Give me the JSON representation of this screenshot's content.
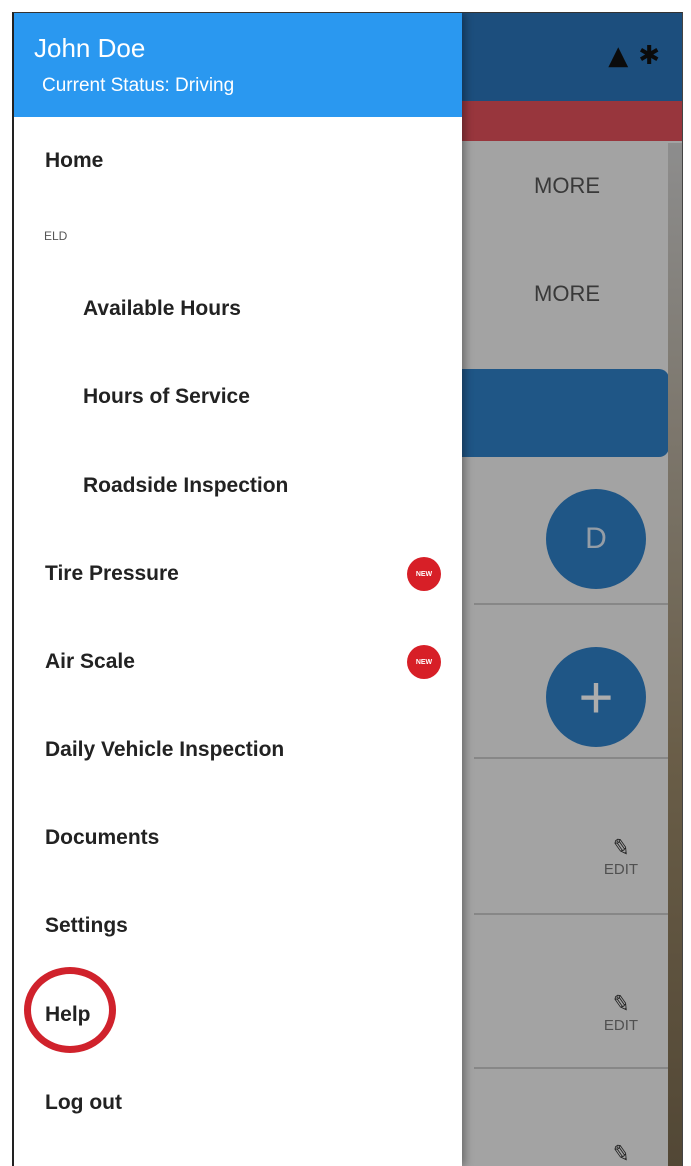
{
  "header": {
    "user_name": "John Doe",
    "status_text": "Current Status: Driving"
  },
  "menu": {
    "home": "Home",
    "section_eld": "ELD",
    "available_hours": "Available Hours",
    "hours_of_service": "Hours of Service",
    "roadside_inspection": "Roadside Inspection",
    "tire_pressure": "Tire Pressure",
    "air_scale": "Air Scale",
    "daily_vehicle_inspection": "Daily Vehicle Inspection",
    "documents": "Documents",
    "settings": "Settings",
    "help": "Help",
    "log_out": "Log out",
    "new_badge": "NEW"
  },
  "background": {
    "more_1": "MORE",
    "more_2": "MORE",
    "fab_letter": "D",
    "fab_plus": "+",
    "edit_1": "EDIT",
    "edit_2": "EDIT"
  },
  "icons": {
    "warning": "warning-icon",
    "bluetooth": "bluetooth-icon",
    "pencil": "pencil-icon",
    "add": "plus-icon"
  },
  "colors": {
    "header_blue": "#2a98f0",
    "app_blue": "#2f7fc6",
    "new_badge_red": "#d71f27",
    "highlight_ring": "#d0222c",
    "alert_bar": "#e1505a"
  }
}
